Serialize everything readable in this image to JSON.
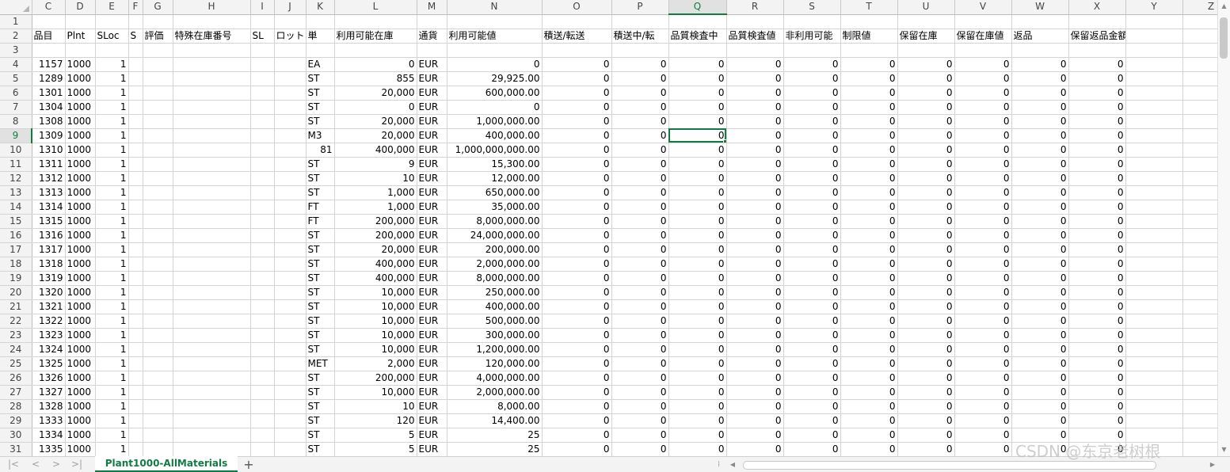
{
  "sheet": {
    "col_headers": [
      "C",
      "D",
      "E",
      "F",
      "G",
      "H",
      "I",
      "J",
      "K",
      "L",
      "M",
      "N",
      "O",
      "P",
      "Q",
      "R",
      "S",
      "T",
      "U",
      "V",
      "W",
      "X",
      "Y",
      "Z"
    ],
    "selected_col": "Q",
    "selected_row": 9,
    "active_cell_value": "0",
    "header_row": [
      "品目",
      "Plnt",
      "SLoc",
      "S",
      "評価",
      "特殊在庫番号",
      "SL",
      "ロット",
      "単",
      "利用可能在庫",
      "通貨",
      "利用可能値",
      "積送/転送",
      "積送中/転",
      "品質検査中",
      "品質検査値",
      "非利用可能",
      "制限値",
      "保留在庫",
      "保留在庫値",
      "返品",
      "保留返品金額",
      "",
      ""
    ],
    "rows": [
      [
        "1157",
        "1000",
        "1",
        "EA",
        "0",
        "EUR",
        "0"
      ],
      [
        "1289",
        "1000",
        "1",
        "ST",
        "855",
        "EUR",
        "29,925.00"
      ],
      [
        "1301",
        "1000",
        "1",
        "ST",
        "20,000",
        "EUR",
        "600,000.00"
      ],
      [
        "1304",
        "1000",
        "1",
        "ST",
        "0",
        "EUR",
        "0"
      ],
      [
        "1308",
        "1000",
        "1",
        "ST",
        "20,000",
        "EUR",
        "1,000,000.00"
      ],
      [
        "1309",
        "1000",
        "1",
        "M3",
        "20,000",
        "EUR",
        "400,000.00"
      ],
      [
        "1310",
        "1000",
        "1",
        "81",
        "400,000",
        "EUR",
        "1,000,000,000.00"
      ],
      [
        "1311",
        "1000",
        "1",
        "ST",
        "9",
        "EUR",
        "15,300.00"
      ],
      [
        "1312",
        "1000",
        "1",
        "ST",
        "10",
        "EUR",
        "12,000.00"
      ],
      [
        "1313",
        "1000",
        "1",
        "ST",
        "1,000",
        "EUR",
        "650,000.00"
      ],
      [
        "1314",
        "1000",
        "1",
        "FT",
        "1,000",
        "EUR",
        "35,000.00"
      ],
      [
        "1315",
        "1000",
        "1",
        "FT",
        "200,000",
        "EUR",
        "8,000,000.00"
      ],
      [
        "1316",
        "1000",
        "1",
        "ST",
        "200,000",
        "EUR",
        "24,000,000.00"
      ],
      [
        "1317",
        "1000",
        "1",
        "ST",
        "20,000",
        "EUR",
        "200,000.00"
      ],
      [
        "1318",
        "1000",
        "1",
        "ST",
        "400,000",
        "EUR",
        "2,000,000.00"
      ],
      [
        "1319",
        "1000",
        "1",
        "ST",
        "400,000",
        "EUR",
        "8,000,000.00"
      ],
      [
        "1320",
        "1000",
        "1",
        "ST",
        "10,000",
        "EUR",
        "250,000.00"
      ],
      [
        "1321",
        "1000",
        "1",
        "ST",
        "10,000",
        "EUR",
        "400,000.00"
      ],
      [
        "1322",
        "1000",
        "1",
        "ST",
        "10,000",
        "EUR",
        "500,000.00"
      ],
      [
        "1323",
        "1000",
        "1",
        "ST",
        "10,000",
        "EUR",
        "300,000.00"
      ],
      [
        "1324",
        "1000",
        "1",
        "ST",
        "10,000",
        "EUR",
        "1,200,000.00"
      ],
      [
        "1325",
        "1000",
        "1",
        "MET",
        "2,000",
        "EUR",
        "120,000.00"
      ],
      [
        "1326",
        "1000",
        "1",
        "ST",
        "200,000",
        "EUR",
        "4,000,000.00"
      ],
      [
        "1327",
        "1000",
        "1",
        "ST",
        "10,000",
        "EUR",
        "2,000,000.00"
      ],
      [
        "1328",
        "1000",
        "1",
        "ST",
        "10",
        "EUR",
        "8,000.00"
      ],
      [
        "1333",
        "1000",
        "1",
        "ST",
        "120",
        "EUR",
        "14,400.00"
      ],
      [
        "1334",
        "1000",
        "1",
        "ST",
        "5",
        "EUR",
        "25"
      ],
      [
        "1335",
        "1000",
        "1",
        "ST",
        "5",
        "EUR",
        "25"
      ]
    ],
    "zero_value": "0"
  },
  "tabs": {
    "active_label": "Plant1000-AllMaterials",
    "add_label": "+",
    "nav": [
      "|<",
      "<",
      ">",
      ">|"
    ]
  },
  "watermark": "CSDN @东京老树根",
  "colors": {
    "accent": "#107c41",
    "grid": "#d4d4d4",
    "header_bg": "#f3f3f3"
  }
}
